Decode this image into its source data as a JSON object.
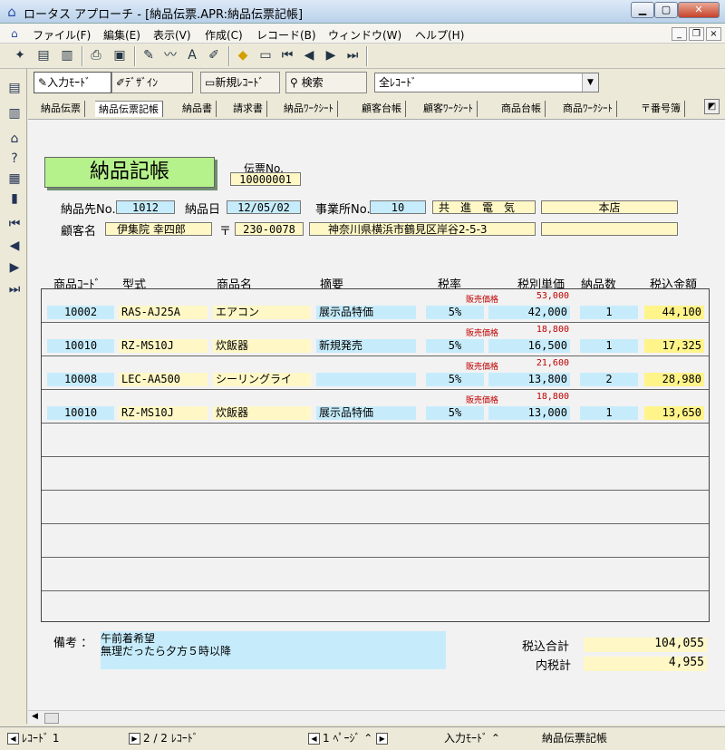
{
  "window": {
    "title": "ロータス アプローチ - [納品伝票.APR:納品伝票記帳]",
    "app_icon": "home-icon"
  },
  "menu": [
    "ファイル(F)",
    "編集(E)",
    "表示(V)",
    "作成(C)",
    "レコード(B)",
    "ウィンドウ(W)",
    "ヘルプ(H)"
  ],
  "mode_bar": {
    "input_mode": "入力ﾓｰﾄﾞ",
    "design": "ﾃﾞｻﾞｲﾝ",
    "new_record": "新規ﾚｺｰﾄﾞ",
    "search": "検索",
    "record_filter": "全ﾚｺｰﾄﾞ"
  },
  "tabs": [
    "納品伝票",
    "納品伝票記帳",
    "納品書",
    "請求書",
    "納品ﾜｰｸｼｰﾄ",
    "顧客台帳",
    "顧客ﾜｰｸｼｰﾄ",
    "商品台帳",
    "商品ﾜｰｸｼｰﾄ",
    "〒番号簿"
  ],
  "form": {
    "title": "納品記帳",
    "slip_no_label": "伝票No.",
    "slip_no": "10000001",
    "dest_no_label": "納品先No.",
    "dest_no": "1012",
    "date_label": "納品日",
    "date": "12/05/02",
    "office_no_label": "事業所No.",
    "office_no": "10",
    "company": "共　進　電　気",
    "branch": "本店",
    "customer_label": "顧客名",
    "customer": "伊集院 幸四郎",
    "postal_mark": "〒",
    "postal_code": "230-0078",
    "address": "神奈川県横浜市鶴見区岸谷2-5-3"
  },
  "headers": {
    "code": "商品ｺｰﾄﾞ",
    "model": "型式",
    "name": "商品名",
    "memo": "摘要",
    "tax_rate": "税率",
    "unit_price": "税別単価",
    "qty": "納品数",
    "total": "税込金額"
  },
  "sale_price_label": "販売価格",
  "rows": [
    {
      "code": "10002",
      "model": "RAS-AJ25A",
      "name": "エアコン",
      "memo": "展示品特価",
      "tax": "5%",
      "sale_price": "53,000",
      "price": "42,000",
      "qty": "1",
      "total": "44,100"
    },
    {
      "code": "10010",
      "model": "RZ-MS10J",
      "name": "炊飯器",
      "memo": "新規発売",
      "tax": "5%",
      "sale_price": "18,800",
      "price": "16,500",
      "qty": "1",
      "total": "17,325"
    },
    {
      "code": "10008",
      "model": "LEC-AA500",
      "name": "シーリングライ",
      "memo": "",
      "tax": "5%",
      "sale_price": "21,600",
      "price": "13,800",
      "qty": "2",
      "total": "28,980"
    },
    {
      "code": "10010",
      "model": "RZ-MS10J",
      "name": "炊飯器",
      "memo": "展示品特価",
      "tax": "5%",
      "sale_price": "18,800",
      "price": "13,000",
      "qty": "1",
      "total": "13,650"
    }
  ],
  "footer": {
    "memo_label": "備考 ：",
    "memo_text": "午前着希望\n無理だったら夕方５時以降",
    "total_label": "税込合計",
    "total": "104,055",
    "tax_label": "内税計",
    "tax": "4,955"
  },
  "status": {
    "record": "ﾚｺｰﾄﾞ 1",
    "record_count": "2 / 2 ﾚｺｰﾄﾞ",
    "page": "1 ﾍﾟｰｼﾞ",
    "mode": "入力ﾓｰﾄﾞ",
    "view": "納品伝票記帳"
  }
}
